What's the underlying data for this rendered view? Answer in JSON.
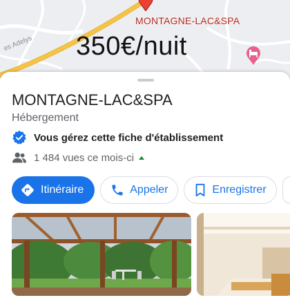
{
  "map": {
    "place_label": "MONTAGNE-LAC&SPA",
    "price_overlay": "350€/nuit",
    "street_label": "es Adelys",
    "pin_color": "#ea4335",
    "road_color": "#f6c343"
  },
  "place": {
    "title": "MONTAGNE-LAC&SPA",
    "category": "Hébergement",
    "managed_text": "Vous gérez cette fiche d'établissement",
    "views_text": "1 484 vues ce mois-ci"
  },
  "actions": [
    {
      "label": "Itinéraire",
      "icon": "directions-icon"
    },
    {
      "label": "Appeler",
      "icon": "phone-icon"
    },
    {
      "label": "Enregistrer",
      "icon": "bookmark-icon"
    }
  ],
  "colors": {
    "accent": "#1a73e8",
    "verified": "#1a73e8"
  }
}
